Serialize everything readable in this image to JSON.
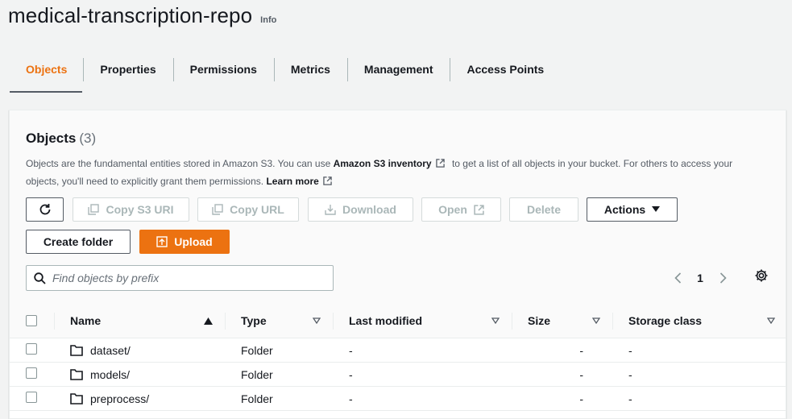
{
  "header": {
    "title": "medical-transcription-repo",
    "info_label": "Info"
  },
  "tabs": [
    {
      "label": "Objects",
      "active": true
    },
    {
      "label": "Properties",
      "active": false
    },
    {
      "label": "Permissions",
      "active": false
    },
    {
      "label": "Metrics",
      "active": false
    },
    {
      "label": "Management",
      "active": false
    },
    {
      "label": "Access Points",
      "active": false
    }
  ],
  "objects_panel": {
    "title": "Objects",
    "count": "(3)",
    "description": {
      "part1": "Objects are the fundamental entities stored in Amazon S3. You can use ",
      "inventory_link": "Amazon S3 inventory",
      "part2": " to get a list of all objects in your bucket. For others to access your objects, you'll need to explicitly grant them permissions. ",
      "learn_more": "Learn more"
    },
    "toolbar": {
      "copy_s3_uri": "Copy S3 URI",
      "copy_url": "Copy URL",
      "download": "Download",
      "open": "Open",
      "delete": "Delete",
      "actions": "Actions",
      "create_folder": "Create folder",
      "upload": "Upload"
    },
    "search": {
      "placeholder": "Find objects by prefix",
      "value": ""
    },
    "pagination": {
      "current_page": "1"
    }
  },
  "table": {
    "columns": [
      "Name",
      "Type",
      "Last modified",
      "Size",
      "Storage class"
    ],
    "rows": [
      {
        "name": "dataset/",
        "type": "Folder",
        "last_modified": "-",
        "size": "-",
        "storage_class": "-"
      },
      {
        "name": "models/",
        "type": "Folder",
        "last_modified": "-",
        "size": "-",
        "storage_class": "-"
      },
      {
        "name": "preprocess/",
        "type": "Folder",
        "last_modified": "-",
        "size": "-",
        "storage_class": "-"
      }
    ]
  },
  "colors": {
    "accent": "#ec7211",
    "text": "#16191f",
    "muted": "#545b64",
    "disabled": "#aab7b8",
    "page_bg": "#f2f3f3"
  },
  "icons": [
    "refresh-icon",
    "copy-icon",
    "download-icon",
    "external-link-icon",
    "caret-down-icon",
    "upload-icon",
    "search-icon",
    "chevron-left-icon",
    "chevron-right-icon",
    "gear-icon",
    "sort-asc-icon",
    "sort-icon",
    "folder-icon"
  ]
}
